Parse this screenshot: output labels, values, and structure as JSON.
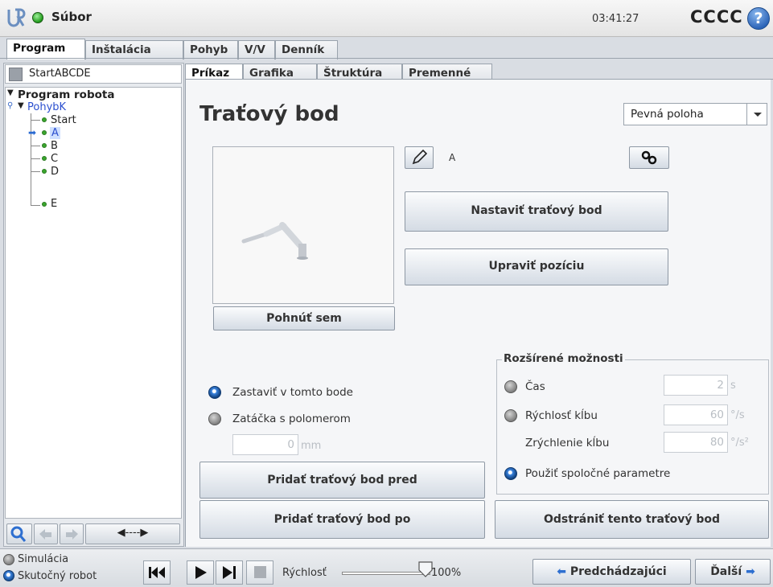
{
  "header": {
    "file_label": "Súbor",
    "clock": "03:41:27",
    "robot_name": "CCCC",
    "help_glyph": "?"
  },
  "main_tabs": [
    {
      "label": "Program"
    },
    {
      "label": "Inštalácia"
    },
    {
      "label": "Pohyb"
    },
    {
      "label": "V/V"
    },
    {
      "label": "Denník"
    }
  ],
  "sub_tabs": [
    {
      "label": "Príkaz"
    },
    {
      "label": "Grafika"
    },
    {
      "label": "Štruktúra"
    },
    {
      "label": "Premenné"
    }
  ],
  "left": {
    "program_name": "StartABCDE",
    "tree": {
      "root": "Program robota",
      "move": "PohybK",
      "items": [
        "Start",
        "A",
        "B",
        "C",
        "D",
        "E"
      ]
    },
    "tool_arrow": "◀----▶"
  },
  "main": {
    "title": "Traťový bod",
    "position_select": "Pevná poloha",
    "waypoint_name": "A",
    "set_waypoint_button": "Nastaviť traťový bod",
    "edit_position_button": "Upraviť pozíciu",
    "move_here_button": "Pohnúť sem",
    "stop_here_label": "Zastaviť v tomto bode",
    "blend_label": "Zatáčka s polomerom",
    "blend_value": "0",
    "blend_unit": "mm",
    "add_before_button": "Pridať traťový bod pred",
    "add_after_button": "Pridať traťový bod po",
    "remove_button": "Odstrániť tento traťový bod",
    "advanced": {
      "title": "Rozšírené možnosti",
      "time_label": "Čas",
      "time_value": "2",
      "time_unit": "s",
      "joint_speed_label": "Rýchlosť kĺbu",
      "joint_speed_value": "60",
      "joint_speed_unit": "°/s",
      "joint_accel_label": "Zrýchlenie kĺbu",
      "joint_accel_value": "80",
      "joint_accel_unit": "°/s²",
      "shared_params_label": "Použiť spoločné parametre"
    }
  },
  "footer": {
    "simulation_label": "Simulácia",
    "real_robot_label": "Skutočný robot",
    "speed_label": "Rýchlosť",
    "speed_value": "100%",
    "prev_button": "Predchádzajúci",
    "next_button": "Ďalší"
  }
}
